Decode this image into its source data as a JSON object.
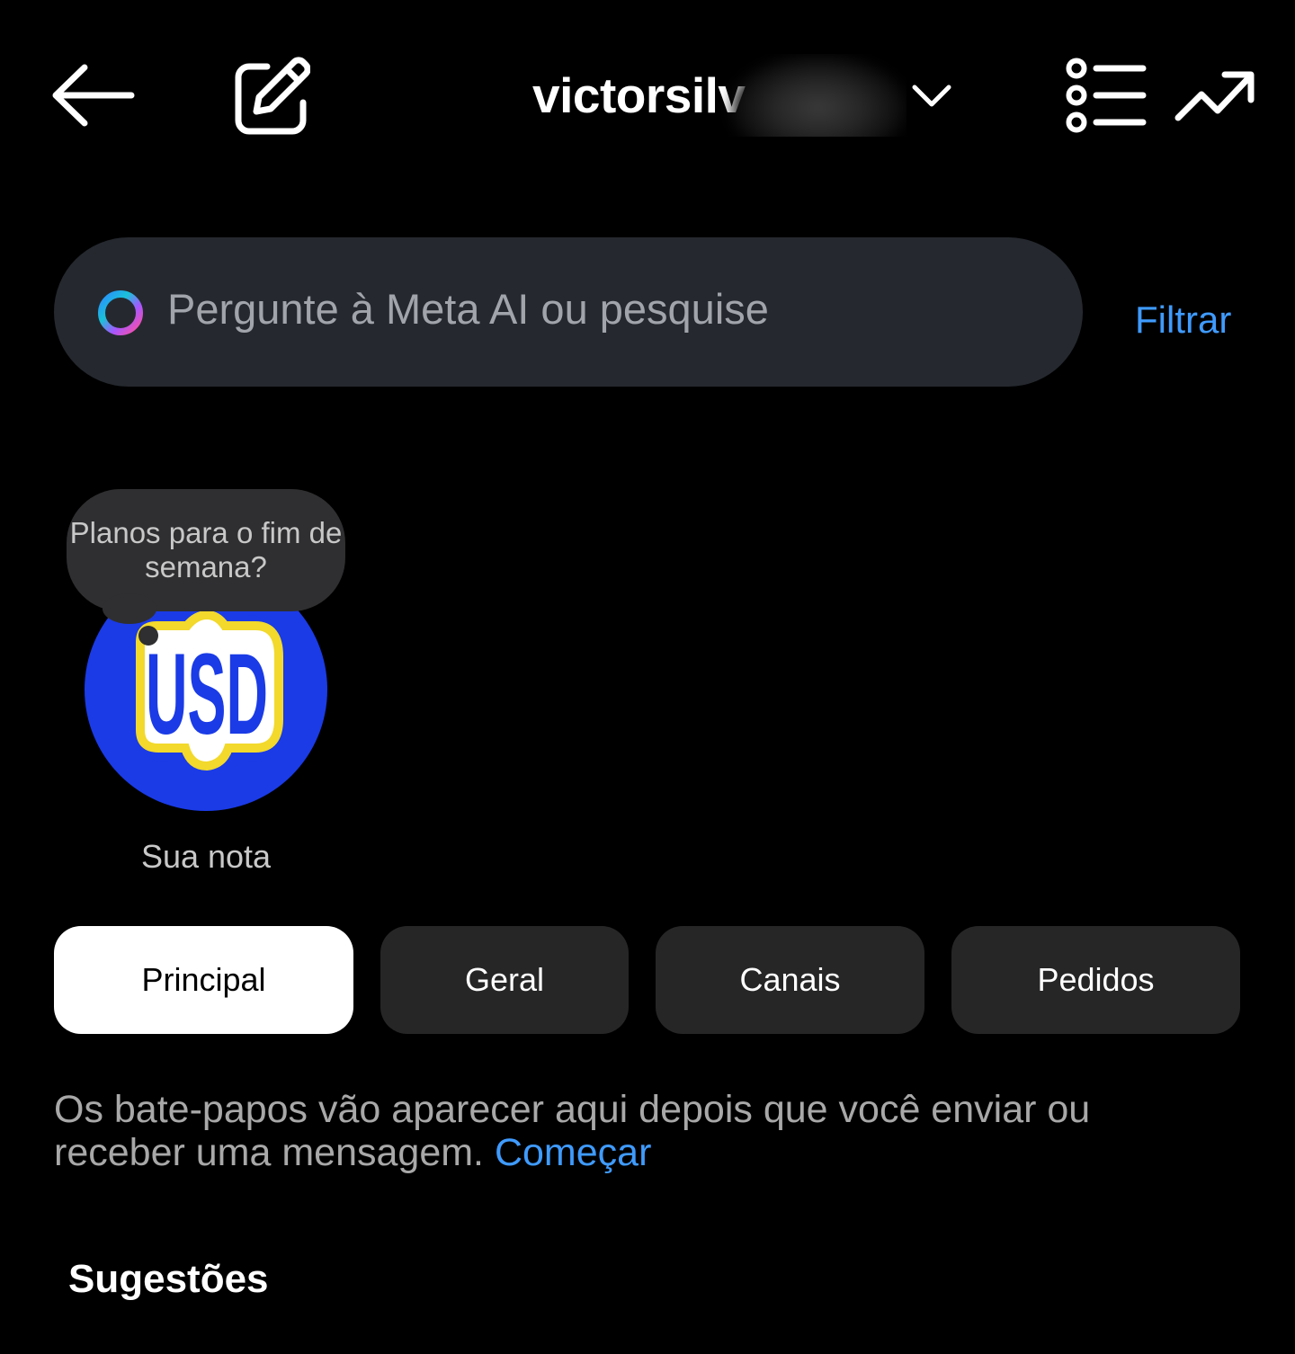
{
  "header": {
    "username": "victorsilv",
    "icons": [
      "back-arrow-icon",
      "compose-icon",
      "chevron-down-icon",
      "list-icon",
      "trending-icon"
    ]
  },
  "search": {
    "placeholder": "Pergunte à Meta AI ou pesquise",
    "filter_label": "Filtrar"
  },
  "note": {
    "text": "Planos para o fim de semana?",
    "label": "Sua nota",
    "avatar_text": "USD"
  },
  "tabs": [
    {
      "label": "Principal",
      "active": true
    },
    {
      "label": "Geral",
      "active": false
    },
    {
      "label": "Canais",
      "active": false
    },
    {
      "label": "Pedidos",
      "active": false
    }
  ],
  "empty_state": {
    "message": "Os bate-papos vão aparecer aqui depois que você enviar ou receber uma mensagem.",
    "link": "Começar"
  },
  "suggestions": {
    "heading": "Sugestões"
  },
  "colors": {
    "background": "#000000",
    "search_bg": "#25292f",
    "link_blue": "#3f9bff",
    "tab_bg": "#262626",
    "avatar_blue": "#1a3be6"
  }
}
